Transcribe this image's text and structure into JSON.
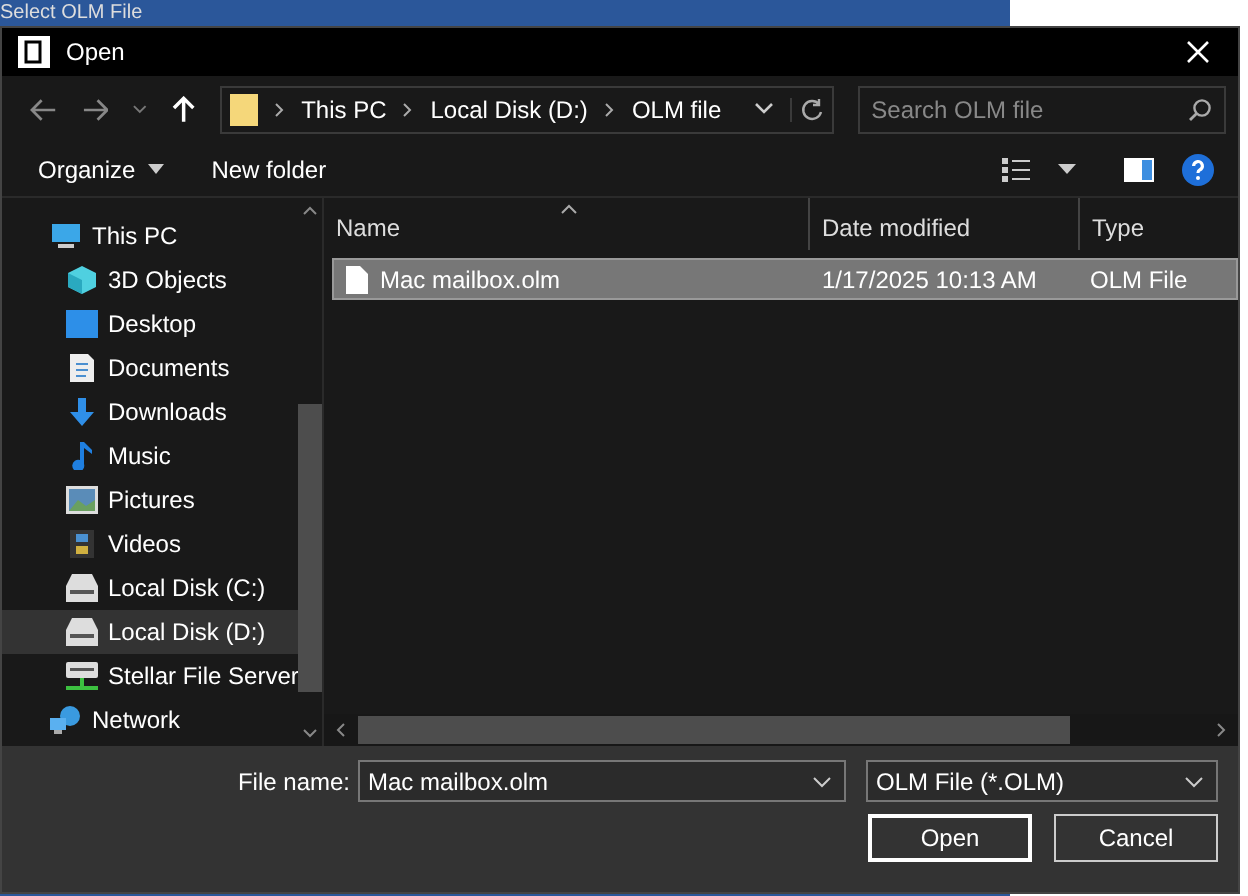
{
  "background_window": {
    "title": "Select OLM File"
  },
  "window": {
    "title": "Open"
  },
  "address_bar": {
    "segments": [
      "This PC",
      "Local Disk (D:)",
      "OLM file"
    ]
  },
  "search": {
    "placeholder": "Search OLM file"
  },
  "toolbar": {
    "organize": "Organize",
    "new_folder": "New folder"
  },
  "sidebar": {
    "items": [
      {
        "label": "This PC",
        "kind": "pc",
        "selected": false,
        "children": [
          {
            "label": "3D Objects",
            "kind": "cube",
            "selected": false
          },
          {
            "label": "Desktop",
            "kind": "desktop",
            "selected": false
          },
          {
            "label": "Documents",
            "kind": "document",
            "selected": false
          },
          {
            "label": "Downloads",
            "kind": "download",
            "selected": false
          },
          {
            "label": "Music",
            "kind": "music",
            "selected": false
          },
          {
            "label": "Pictures",
            "kind": "picture",
            "selected": false
          },
          {
            "label": "Videos",
            "kind": "video",
            "selected": false
          },
          {
            "label": "Local Disk (C:)",
            "kind": "drive",
            "selected": false
          },
          {
            "label": "Local Disk (D:)",
            "kind": "drive",
            "selected": true
          },
          {
            "label": "Stellar File Server",
            "kind": "server",
            "selected": false
          }
        ]
      },
      {
        "label": "Network",
        "kind": "network",
        "selected": false
      }
    ]
  },
  "table": {
    "columns": [
      "Name",
      "Date modified",
      "Type"
    ],
    "rows": [
      {
        "name": "Mac mailbox.olm",
        "date": "1/17/2025 10:13 AM",
        "type": "OLM File",
        "selected": true
      }
    ]
  },
  "footer": {
    "file_name_label": "File name:",
    "file_name": "Mac mailbox.olm",
    "file_type": "OLM File (*.OLM)",
    "buttons": [
      "Open",
      "Cancel"
    ]
  }
}
